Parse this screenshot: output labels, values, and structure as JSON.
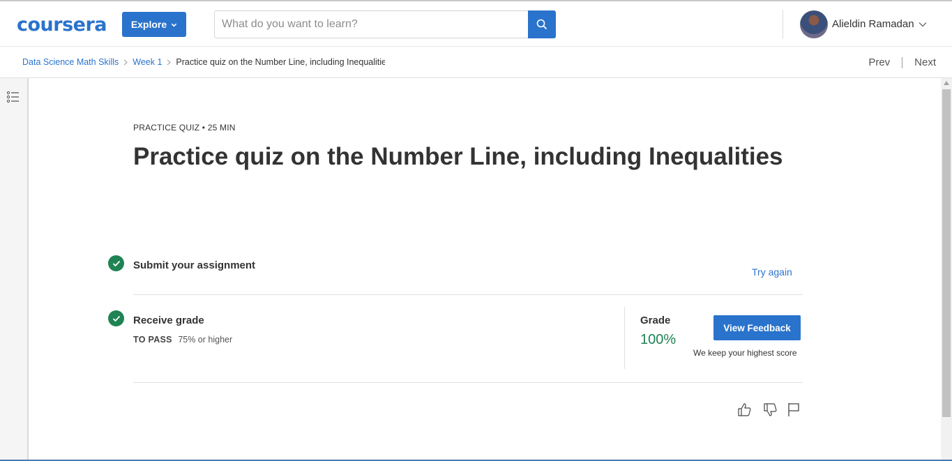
{
  "header": {
    "logo": "coursera",
    "explore_label": "Explore",
    "search_placeholder": "What do you want to learn?",
    "user_name": "Alieldin Ramadan"
  },
  "breadcrumb": {
    "items": [
      "Data Science Math Skills",
      "Week 1"
    ],
    "current": "Practice quiz on the Number Line, including Inequalities"
  },
  "nav": {
    "prev": "Prev",
    "next": "Next"
  },
  "quiz": {
    "meta": "PRACTICE QUIZ • 25 MIN",
    "title": "Practice quiz on the Number Line, including Inequalities"
  },
  "steps": {
    "submit": {
      "title": "Submit your assignment",
      "action": "Try again"
    },
    "receive": {
      "title": "Receive grade",
      "to_pass_label": "TO PASS",
      "to_pass_value": "75% or higher",
      "grade_label": "Grade",
      "grade_value": "100%",
      "feedback_button": "View Feedback",
      "note": "We keep your highest score"
    }
  },
  "icons": {
    "search": "search-icon",
    "toggle": "list-icon",
    "like": "thumbs-up-icon",
    "dislike": "thumbs-down-icon",
    "flag": "flag-icon"
  },
  "colors": {
    "brand": "#2a73cc",
    "success": "#1f8354"
  }
}
